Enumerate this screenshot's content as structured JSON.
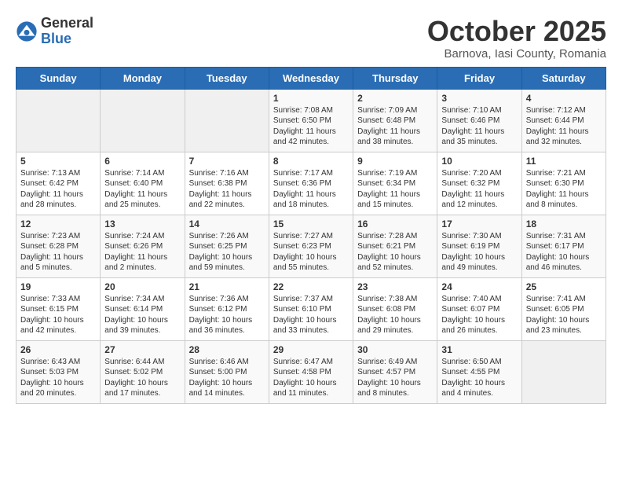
{
  "app": {
    "logo_general": "General",
    "logo_blue": "Blue"
  },
  "title": "October 2025",
  "location": "Barnova, Iasi County, Romania",
  "days_of_week": [
    "Sunday",
    "Monday",
    "Tuesday",
    "Wednesday",
    "Thursday",
    "Friday",
    "Saturday"
  ],
  "weeks": [
    [
      {
        "day": "",
        "info": ""
      },
      {
        "day": "",
        "info": ""
      },
      {
        "day": "",
        "info": ""
      },
      {
        "day": "1",
        "info": "Sunrise: 7:08 AM\nSunset: 6:50 PM\nDaylight: 11 hours and 42 minutes."
      },
      {
        "day": "2",
        "info": "Sunrise: 7:09 AM\nSunset: 6:48 PM\nDaylight: 11 hours and 38 minutes."
      },
      {
        "day": "3",
        "info": "Sunrise: 7:10 AM\nSunset: 6:46 PM\nDaylight: 11 hours and 35 minutes."
      },
      {
        "day": "4",
        "info": "Sunrise: 7:12 AM\nSunset: 6:44 PM\nDaylight: 11 hours and 32 minutes."
      }
    ],
    [
      {
        "day": "5",
        "info": "Sunrise: 7:13 AM\nSunset: 6:42 PM\nDaylight: 11 hours and 28 minutes."
      },
      {
        "day": "6",
        "info": "Sunrise: 7:14 AM\nSunset: 6:40 PM\nDaylight: 11 hours and 25 minutes."
      },
      {
        "day": "7",
        "info": "Sunrise: 7:16 AM\nSunset: 6:38 PM\nDaylight: 11 hours and 22 minutes."
      },
      {
        "day": "8",
        "info": "Sunrise: 7:17 AM\nSunset: 6:36 PM\nDaylight: 11 hours and 18 minutes."
      },
      {
        "day": "9",
        "info": "Sunrise: 7:19 AM\nSunset: 6:34 PM\nDaylight: 11 hours and 15 minutes."
      },
      {
        "day": "10",
        "info": "Sunrise: 7:20 AM\nSunset: 6:32 PM\nDaylight: 11 hours and 12 minutes."
      },
      {
        "day": "11",
        "info": "Sunrise: 7:21 AM\nSunset: 6:30 PM\nDaylight: 11 hours and 8 minutes."
      }
    ],
    [
      {
        "day": "12",
        "info": "Sunrise: 7:23 AM\nSunset: 6:28 PM\nDaylight: 11 hours and 5 minutes."
      },
      {
        "day": "13",
        "info": "Sunrise: 7:24 AM\nSunset: 6:26 PM\nDaylight: 11 hours and 2 minutes."
      },
      {
        "day": "14",
        "info": "Sunrise: 7:26 AM\nSunset: 6:25 PM\nDaylight: 10 hours and 59 minutes."
      },
      {
        "day": "15",
        "info": "Sunrise: 7:27 AM\nSunset: 6:23 PM\nDaylight: 10 hours and 55 minutes."
      },
      {
        "day": "16",
        "info": "Sunrise: 7:28 AM\nSunset: 6:21 PM\nDaylight: 10 hours and 52 minutes."
      },
      {
        "day": "17",
        "info": "Sunrise: 7:30 AM\nSunset: 6:19 PM\nDaylight: 10 hours and 49 minutes."
      },
      {
        "day": "18",
        "info": "Sunrise: 7:31 AM\nSunset: 6:17 PM\nDaylight: 10 hours and 46 minutes."
      }
    ],
    [
      {
        "day": "19",
        "info": "Sunrise: 7:33 AM\nSunset: 6:15 PM\nDaylight: 10 hours and 42 minutes."
      },
      {
        "day": "20",
        "info": "Sunrise: 7:34 AM\nSunset: 6:14 PM\nDaylight: 10 hours and 39 minutes."
      },
      {
        "day": "21",
        "info": "Sunrise: 7:36 AM\nSunset: 6:12 PM\nDaylight: 10 hours and 36 minutes."
      },
      {
        "day": "22",
        "info": "Sunrise: 7:37 AM\nSunset: 6:10 PM\nDaylight: 10 hours and 33 minutes."
      },
      {
        "day": "23",
        "info": "Sunrise: 7:38 AM\nSunset: 6:08 PM\nDaylight: 10 hours and 29 minutes."
      },
      {
        "day": "24",
        "info": "Sunrise: 7:40 AM\nSunset: 6:07 PM\nDaylight: 10 hours and 26 minutes."
      },
      {
        "day": "25",
        "info": "Sunrise: 7:41 AM\nSunset: 6:05 PM\nDaylight: 10 hours and 23 minutes."
      }
    ],
    [
      {
        "day": "26",
        "info": "Sunrise: 6:43 AM\nSunset: 5:03 PM\nDaylight: 10 hours and 20 minutes."
      },
      {
        "day": "27",
        "info": "Sunrise: 6:44 AM\nSunset: 5:02 PM\nDaylight: 10 hours and 17 minutes."
      },
      {
        "day": "28",
        "info": "Sunrise: 6:46 AM\nSunset: 5:00 PM\nDaylight: 10 hours and 14 minutes."
      },
      {
        "day": "29",
        "info": "Sunrise: 6:47 AM\nSunset: 4:58 PM\nDaylight: 10 hours and 11 minutes."
      },
      {
        "day": "30",
        "info": "Sunrise: 6:49 AM\nSunset: 4:57 PM\nDaylight: 10 hours and 8 minutes."
      },
      {
        "day": "31",
        "info": "Sunrise: 6:50 AM\nSunset: 4:55 PM\nDaylight: 10 hours and 4 minutes."
      },
      {
        "day": "",
        "info": ""
      }
    ]
  ]
}
